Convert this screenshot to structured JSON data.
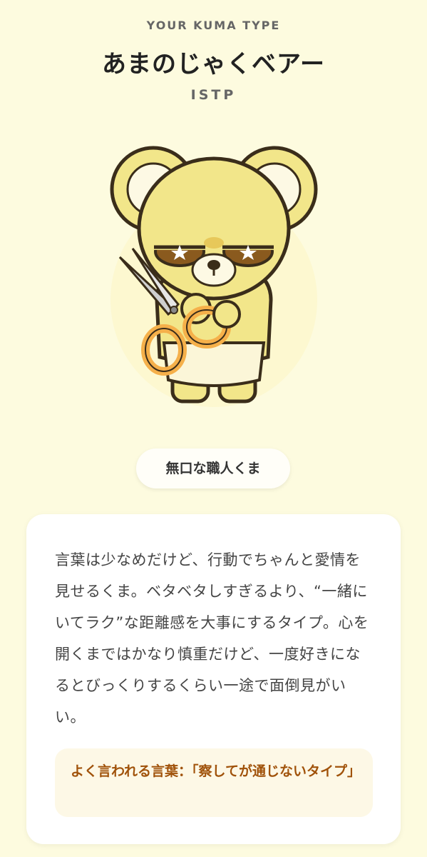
{
  "header": {
    "kicker": "YOUR KUMA TYPE",
    "type_name": "あまのじゃくベアー",
    "type_code": "ISTP"
  },
  "illustration": {
    "icon": "bear-with-scissors-illustration",
    "colors": {
      "bear_body": "#f2e68a",
      "outline": "#3a2d1a",
      "scissors_handle": "#f5b04a",
      "apron": "#fbf6d8"
    }
  },
  "tag": {
    "label": "無口な職人くま"
  },
  "card": {
    "description": "言葉は少なめだけど、行動でちゃんと愛情を見せるくま。ベタベタしすぎるより、“一緒にいてラク”な距離感を大事にするタイプ。心を開くまではかなり慎重だけど、一度好きになるとびっくりするくらい一途で面倒見がいい。",
    "quote": "よく言われる言葉：「察してが通じないタイプ」"
  },
  "colors": {
    "page_background": "#fdfbdf",
    "quote_text": "#a0520a",
    "quote_background": "#fdf8e6"
  }
}
